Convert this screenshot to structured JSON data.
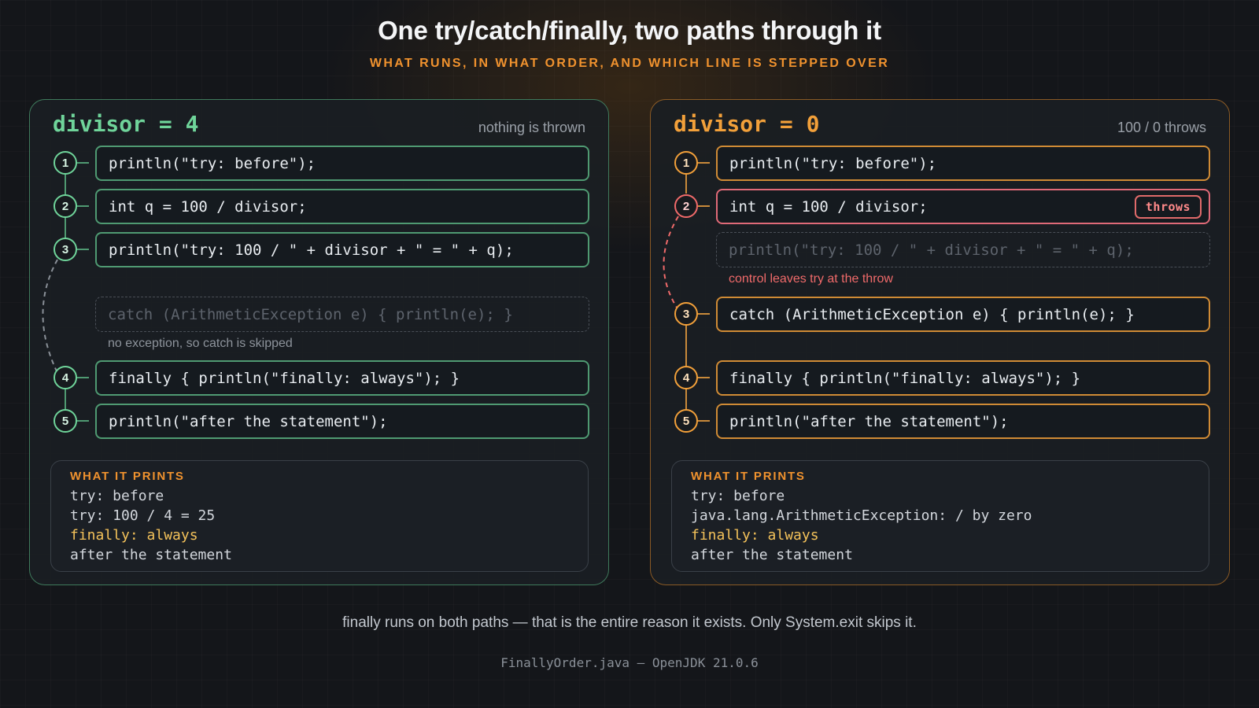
{
  "title": "One try/catch/finally, two paths through it",
  "subtitle": "WHAT RUNS, IN WHAT ORDER, AND WHICH LINE IS STEPPED OVER",
  "left": {
    "heading": "divisor = 4",
    "note": "nothing is thrown",
    "lines": [
      {
        "step": "1",
        "code": "println(\"try: before\");"
      },
      {
        "step": "2",
        "code": "int q = 100 / divisor;"
      },
      {
        "step": "3",
        "code": "println(\"try: 100 / \" + divisor + \" = \" + q);"
      },
      {
        "code": "catch (ArithmeticException e) { println(e); }"
      },
      {
        "step": "4",
        "code": "finally { println(\"finally: always\"); }"
      },
      {
        "step": "5",
        "code": "println(\"after the statement\");"
      }
    ],
    "skip_caption": "no exception, so catch is skipped",
    "output": {
      "label": "WHAT IT PRINTS",
      "lines": [
        "try: before",
        "try: 100 / 4 = 25",
        "finally: always",
        "after the statement"
      ]
    }
  },
  "right": {
    "heading": "divisor = 0",
    "note": "100 / 0 throws",
    "badge": "throws",
    "lines": [
      {
        "step": "1",
        "code": "println(\"try: before\");"
      },
      {
        "step": "2",
        "code": "int q = 100 / divisor;"
      },
      {
        "code": "println(\"try: 100 / \" + divisor + \" = \" + q);"
      },
      {
        "step": "3",
        "code": "catch (ArithmeticException e) { println(e); }"
      },
      {
        "step": "4",
        "code": "finally { println(\"finally: always\"); }"
      },
      {
        "step": "5",
        "code": "println(\"after the statement\");"
      }
    ],
    "skip_caption": "control leaves try at the throw",
    "output": {
      "label": "WHAT IT PRINTS",
      "lines": [
        "try: before",
        "java.lang.ArithmeticException: / by zero",
        "finally: always",
        "after the statement"
      ]
    }
  },
  "colors": {
    "normal_path": "#6fd49a",
    "exception_path": "#f2a03a",
    "error": "#f06a6a",
    "highlight_output": "#f4c25a"
  },
  "footnote": "finally runs on both paths — that is the entire reason it exists. Only System.exit skips it.",
  "source": "FinallyOrder.java — OpenJDK 21.0.6"
}
